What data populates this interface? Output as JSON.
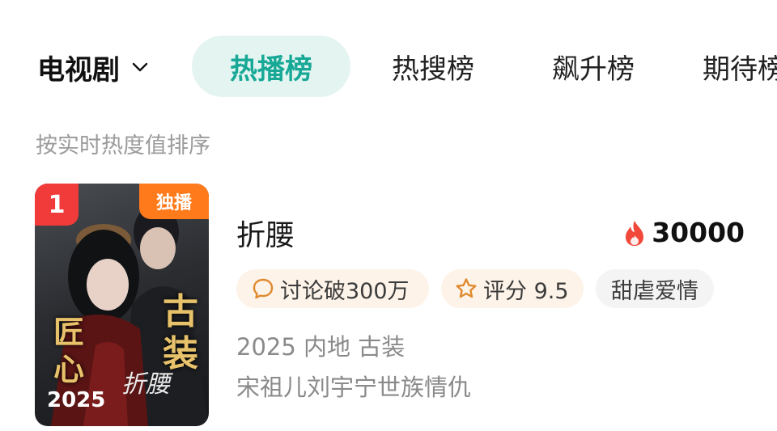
{
  "category": {
    "label": "电视剧",
    "icon": "chevron-down-icon"
  },
  "tabs": [
    {
      "label": "热播榜",
      "active": true
    },
    {
      "label": "热搜榜",
      "active": false
    },
    {
      "label": "飙升榜",
      "active": false
    },
    {
      "label": "期待榜",
      "active": false
    }
  ],
  "subtitle": "按实时热度值排序",
  "items": [
    {
      "rank": "1",
      "badge": "独播",
      "poster": {
        "title_right": "古装",
        "title_left": "匠心",
        "logo": "折腰",
        "year": "2025"
      },
      "title": "折腰",
      "heat": "30000",
      "tags": [
        {
          "label": "讨论破300万",
          "icon": "chat-bubble-icon"
        },
        {
          "label": "评分 9.5",
          "icon": "star-outline-icon"
        },
        {
          "label": "甜虐爱情"
        }
      ],
      "meta": "2025 内地 古装",
      "description": "宋祖儿刘宇宁世族情仇"
    }
  ],
  "colors": {
    "accent": "#17a896",
    "active_tab_bg": "#e4f5f1",
    "rank_badge": "#f13b3b",
    "exclusive_badge": "#ff7a1a",
    "flame": "#f2483a",
    "tag_icon": "#e08a2e"
  }
}
